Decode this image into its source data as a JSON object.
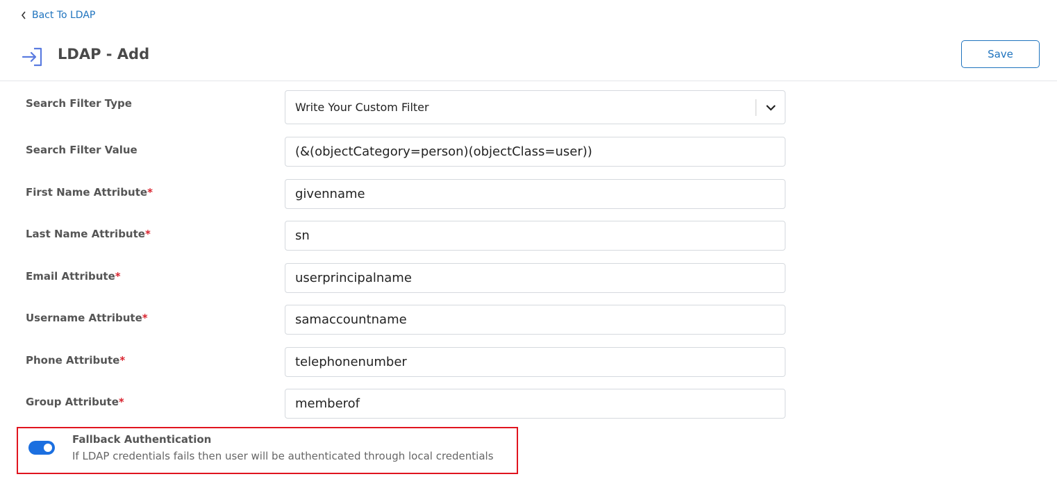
{
  "nav": {
    "back_label": "Bact To LDAP"
  },
  "header": {
    "title": "LDAP - Add",
    "save_label": "Save"
  },
  "form": {
    "search_filter_type": {
      "label": "Search Filter Type",
      "value": "Write Your Custom Filter"
    },
    "search_filter_value": {
      "label": "Search Filter Value",
      "value": "(&(objectCategory=person)(objectClass=user))"
    },
    "first_name": {
      "label": "First Name Attribute",
      "required": "*",
      "value": "givenname"
    },
    "last_name": {
      "label": "Last Name Attribute",
      "required": "*",
      "value": "sn"
    },
    "email": {
      "label": "Email Attribute",
      "required": "*",
      "value": "userprincipalname"
    },
    "username": {
      "label": "Username Attribute",
      "required": "*",
      "value": "samaccountname"
    },
    "phone": {
      "label": "Phone Attribute",
      "required": "*",
      "value": "telephonenumber"
    },
    "group": {
      "label": "Group Attribute",
      "required": "*",
      "value": "memberof"
    }
  },
  "fallback": {
    "title": "Fallback Authentication",
    "description": "If LDAP credentials fails then user will be authenticated through local credentials",
    "enabled": true
  },
  "colors": {
    "accent": "#1e73be",
    "toggle_on": "#1b6fe0",
    "highlight_border": "#e0141e",
    "required": "#d9232e"
  }
}
